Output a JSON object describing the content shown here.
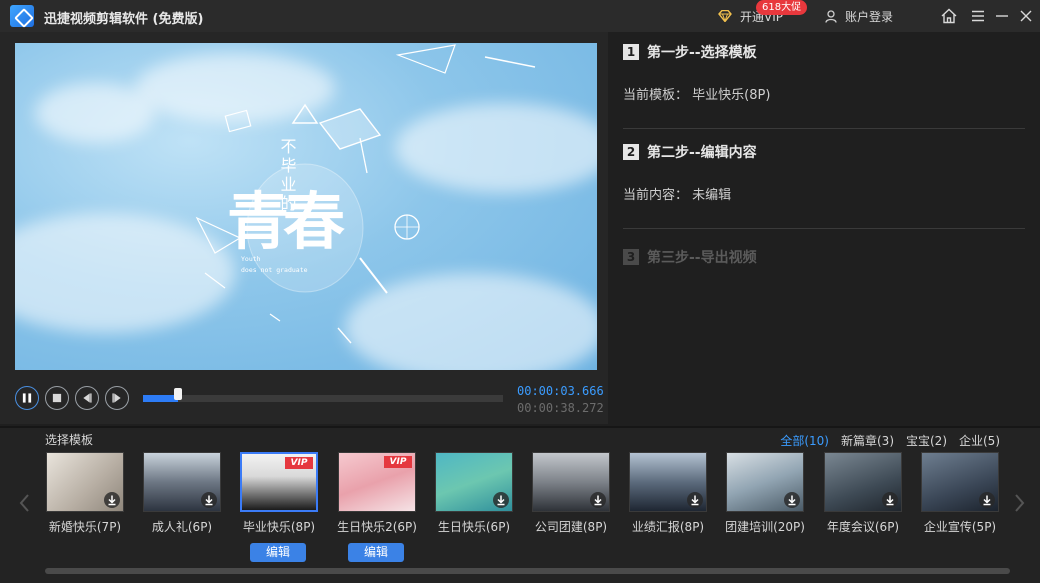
{
  "app": {
    "title": "迅捷视频剪辑软件 (免费版)",
    "vip_label": "开通VIP",
    "promo_badge": "618大促",
    "account_label": "账户登录",
    "accent_color": "#3b82e6"
  },
  "player": {
    "current_time": "00:00:03.666",
    "total_time": "00:00:38.272",
    "progress": 0.096,
    "video_caption": {
      "vertical_title": "不毕业的",
      "big_title": "青春",
      "subtitle_line1": "Youth",
      "subtitle_line2": "does not graduate"
    }
  },
  "steps": [
    {
      "num": "1",
      "title": "第一步--选择模板",
      "info_label": "当前模板：",
      "info_value": "毕业快乐(8P)"
    },
    {
      "num": "2",
      "title": "第二步--编辑内容",
      "info_label": "当前内容：",
      "info_value": "未编辑"
    },
    {
      "num": "3",
      "title": "第三步--导出视频"
    }
  ],
  "strip": {
    "title": "选择模板",
    "filters": [
      "全部(10)",
      "新篇章(3)",
      "宝宝(2)",
      "企业(5)"
    ],
    "edit_label": "编辑",
    "vip_tag": "VIP",
    "templates": [
      {
        "name": "新婚快乐(7P)",
        "theme": "wedding"
      },
      {
        "name": "成人礼(6P)",
        "theme": "ceremony"
      },
      {
        "name": "毕业快乐(8P)",
        "theme": "graduation",
        "vip": true,
        "selected": true
      },
      {
        "name": "生日快乐2(6P)",
        "theme": "birthday-cake",
        "vip": true
      },
      {
        "name": "生日快乐(6P)",
        "theme": "birthday-kid"
      },
      {
        "name": "公司团建(8P)",
        "theme": "team"
      },
      {
        "name": "业绩汇报(8P)",
        "theme": "report"
      },
      {
        "name": "团建培训(20P)",
        "theme": "training"
      },
      {
        "name": "年度会议(6P)",
        "theme": "meeting"
      },
      {
        "name": "企业宣传(5P)",
        "theme": "promo"
      }
    ]
  }
}
